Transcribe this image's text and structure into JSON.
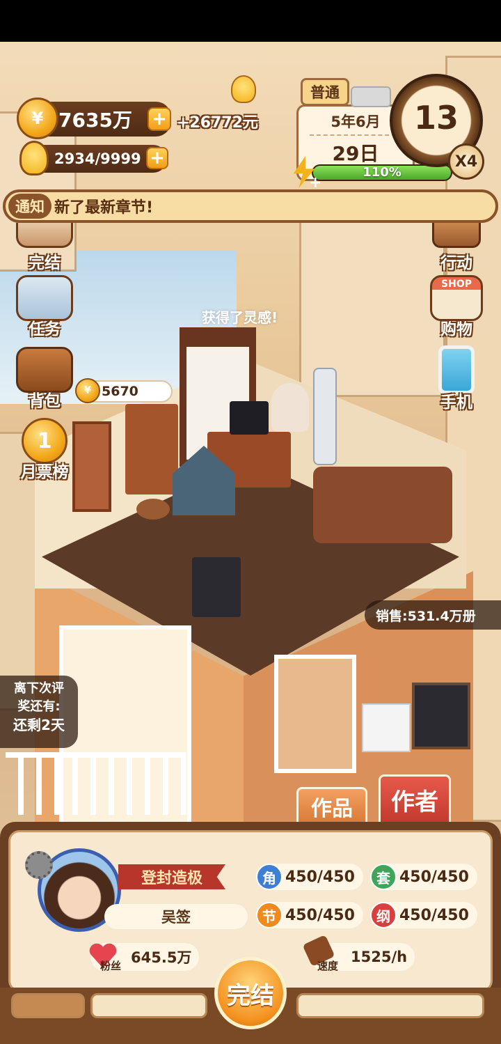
{
  "resources": {
    "coins": "7635万",
    "coin_income": "+26772元",
    "inspiration": "2934/9999"
  },
  "calendar": {
    "difficulty": "普通",
    "month": "5年6月",
    "day": "29日",
    "energy_percent": 1.1,
    "energy_label": "110%"
  },
  "clock": {
    "hour": "13",
    "speed_multiplier": "X4"
  },
  "notice": {
    "tag": "通知",
    "text": "新了最新章节!"
  },
  "left_menu": {
    "finish": "完结",
    "tasks": "任务",
    "backpack": "背包",
    "monthly_rank": "月票榜"
  },
  "right_menu": {
    "action": "行动",
    "shop_sign": "SHOP",
    "shopping": "购物",
    "phone": "手机"
  },
  "floating": {
    "inspiration_msg": "获得了灵感!"
  },
  "room": {
    "coin_bubble": "5670"
  },
  "sales": {
    "label": "销售:",
    "value": "531.4万册"
  },
  "award_timer": {
    "line1": "离下次评",
    "line2": "奖还有:",
    "line3": "还剩2天"
  },
  "tabs": {
    "works": "作品",
    "author": "作者"
  },
  "profile": {
    "title": "登封造极",
    "name": "吴签",
    "fans_label": "粉丝",
    "fans_value": "645.5万",
    "speed_label": "速度",
    "speed_value": "1525/h"
  },
  "stats": [
    {
      "badge": "角",
      "value": "450/450",
      "color": "#3e7fd3"
    },
    {
      "badge": "套",
      "value": "450/450",
      "color": "#3ea55a"
    },
    {
      "badge": "节",
      "value": "450/450",
      "color": "#ef8a1e"
    },
    {
      "badge": "纲",
      "value": "450/450",
      "color": "#d8403f"
    }
  ],
  "actions": {
    "finish": "完结"
  }
}
